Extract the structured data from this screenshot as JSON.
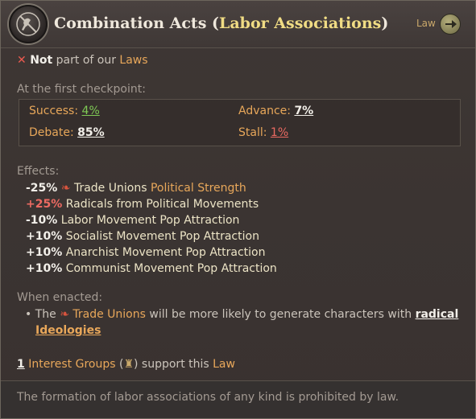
{
  "header": {
    "title_main": "Combination Acts (",
    "title_highlight": "Labor Associations",
    "title_end": ")",
    "law_tag": "Law"
  },
  "status": {
    "not_label": "Not",
    "text": " part of our ",
    "laws_link": "Laws"
  },
  "checkpoint": {
    "heading": "At the first checkpoint:",
    "success_label": "Success: ",
    "success_value": "4%",
    "advance_label": "Advance: ",
    "advance_value": "7%",
    "debate_label": "Debate: ",
    "debate_value": "85%",
    "stall_label": "Stall: ",
    "stall_value": "1%"
  },
  "effects": {
    "heading": "Effects:",
    "items": [
      {
        "value": "-25%",
        "text": " Trade Unions ",
        "extra": "Political Strength"
      },
      {
        "value": "+25%",
        "text": " Radicals from Political Movements"
      },
      {
        "value": "-10%",
        "text": " Labor Movement Pop Attraction"
      },
      {
        "value": "+10%",
        "text": " Socialist Movement Pop Attraction"
      },
      {
        "value": "+10%",
        "text": " Anarchist Movement Pop Attraction"
      },
      {
        "value": "+10%",
        "text": " Communist Movement Pop Attraction"
      }
    ]
  },
  "enacted": {
    "heading": "When enacted:",
    "bullet_prefix": "• The ",
    "group": "Trade Unions",
    "text": " will be more likely to generate characters with ",
    "link1": "radical",
    "link2": "Ideologies"
  },
  "support": {
    "count": "1",
    "ig_link": "Interest Groups",
    "paren_open": " (",
    "paren_close": ") support this ",
    "law_link": "Law"
  },
  "footer": {
    "description": "The formation of labor associations of any kind is prohibited by law."
  },
  "colors": {
    "positive": "#7fca55",
    "negative": "#ec6a62",
    "link": "#e8a75a"
  }
}
